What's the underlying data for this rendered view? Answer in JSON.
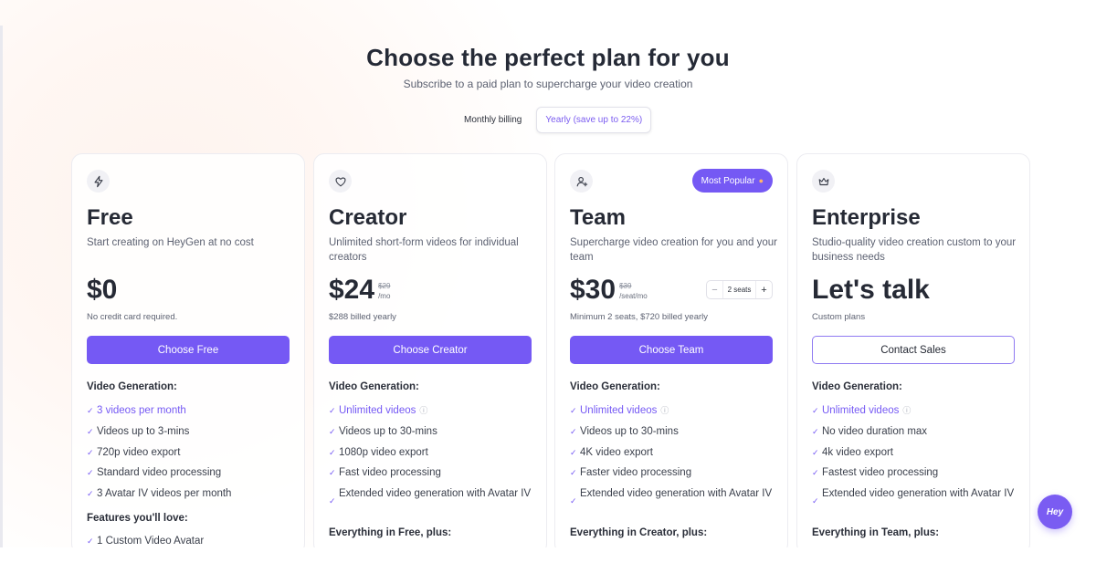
{
  "header": {
    "title": "Choose the perfect plan for you",
    "subtitle": "Subscribe to a paid plan to supercharge your video creation"
  },
  "billing": {
    "monthly": "Monthly billing",
    "yearly": "Yearly (save up to 22%)",
    "selected": "yearly"
  },
  "plans": [
    {
      "icon": "bolt-icon",
      "name": "Free",
      "desc": "Start creating on HeyGen at no cost",
      "price": "$0",
      "billed": "No credit card required.",
      "cta": "Choose Free",
      "section": "Video Generation:",
      "features": [
        "3 videos per month",
        "Videos up to 3-mins",
        "720p video export",
        "Standard video processing",
        "3 Avatar IV videos per month"
      ],
      "section2": "Features you'll love:",
      "features2": [
        "1 Custom Video Avatar"
      ]
    },
    {
      "icon": "heart-icon",
      "name": "Creator",
      "desc": "Unlimited short-form videos for individual creators",
      "price": "$24",
      "old_price": "$29",
      "per": "/mo",
      "billed": "$288 billed yearly",
      "cta": "Choose Creator",
      "section": "Video Generation:",
      "features": [
        "Unlimited videos",
        "Videos up to 30-mins",
        "1080p video export",
        "Fast video processing",
        "Extended video generation with Avatar IV"
      ],
      "section2": "Everything in Free, plus:"
    },
    {
      "icon": "user-plus-icon",
      "name": "Team",
      "badge": "Most Popular",
      "desc": "Supercharge video creation for you and your team",
      "price": "$30",
      "old_price": "$39",
      "per": "/seat/mo",
      "seats": "2 seats",
      "billed": "Minimum 2 seats, $720 billed yearly",
      "cta": "Choose Team",
      "section": "Video Generation:",
      "features": [
        "Unlimited videos",
        "Videos up to 30-mins",
        "4K video export",
        "Faster video processing",
        "Extended video generation with Avatar IV"
      ],
      "section2": "Everything in Creator, plus:"
    },
    {
      "icon": "crown-icon",
      "name": "Enterprise",
      "desc": "Studio-quality video creation custom to your business needs",
      "price": "Let's talk",
      "billed": "Custom plans",
      "cta": "Contact Sales",
      "section": "Video Generation:",
      "features": [
        "Unlimited videos",
        "No video duration max",
        "4k video export",
        "Fastest video processing",
        "Extended video generation with Avatar IV"
      ],
      "section2": "Everything in Team, plus:"
    }
  ],
  "chat": {
    "label": "Hey"
  },
  "colors": {
    "accent": "#7559f4",
    "text": "#262a35",
    "muted": "#5d6272"
  }
}
